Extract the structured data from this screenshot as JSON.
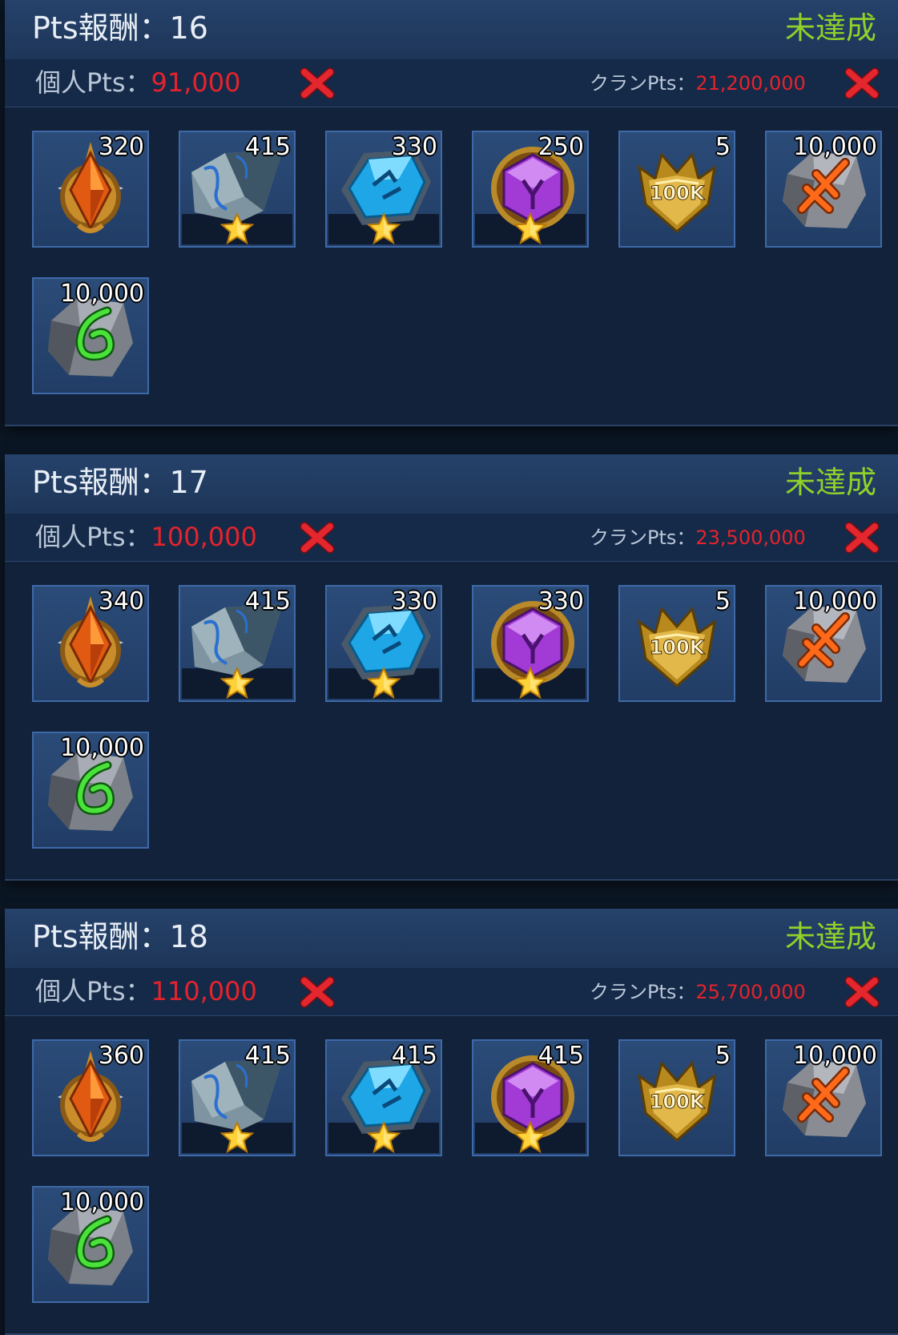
{
  "colors": {
    "status": "#8fd12a",
    "requirement_value": "#e5232c",
    "panel_bg": "#12223a",
    "header_bg": "#24406a"
  },
  "panels": [
    {
      "title": "Pts報酬：16",
      "status": "未達成",
      "personal_label": "個人Pts：",
      "personal_value": "91,000",
      "clan_label": "クランPts：",
      "clan_value": "21,200,000",
      "items": [
        {
          "icon": "orange-gem-emblem",
          "count": "320",
          "star": false
        },
        {
          "icon": "grey-stone-shard",
          "count": "415",
          "star": true
        },
        {
          "icon": "blue-crystal-rune",
          "count": "330",
          "star": true
        },
        {
          "icon": "purple-rune-medallion",
          "count": "250",
          "star": true
        },
        {
          "icon": "gold-100k-crest",
          "count": "5",
          "star": false,
          "badge": "100K"
        },
        {
          "icon": "orange-rune-stone",
          "count": "10,000",
          "star": false
        },
        {
          "icon": "green-rune-stone",
          "count": "10,000",
          "star": false
        }
      ]
    },
    {
      "title": "Pts報酬：17",
      "status": "未達成",
      "personal_label": "個人Pts：",
      "personal_value": "100,000",
      "clan_label": "クランPts：",
      "clan_value": "23,500,000",
      "items": [
        {
          "icon": "orange-gem-emblem",
          "count": "340",
          "star": false
        },
        {
          "icon": "grey-stone-shard",
          "count": "415",
          "star": true
        },
        {
          "icon": "blue-crystal-rune",
          "count": "330",
          "star": true
        },
        {
          "icon": "purple-rune-medallion",
          "count": "330",
          "star": true
        },
        {
          "icon": "gold-100k-crest",
          "count": "5",
          "star": false,
          "badge": "100K"
        },
        {
          "icon": "orange-rune-stone",
          "count": "10,000",
          "star": false
        },
        {
          "icon": "green-rune-stone",
          "count": "10,000",
          "star": false
        }
      ]
    },
    {
      "title": "Pts報酬：18",
      "status": "未達成",
      "personal_label": "個人Pts：",
      "personal_value": "110,000",
      "clan_label": "クランPts：",
      "clan_value": "25,700,000",
      "items": [
        {
          "icon": "orange-gem-emblem",
          "count": "360",
          "star": false
        },
        {
          "icon": "grey-stone-shard",
          "count": "415",
          "star": true
        },
        {
          "icon": "blue-crystal-rune",
          "count": "415",
          "star": true
        },
        {
          "icon": "purple-rune-medallion",
          "count": "415",
          "star": true
        },
        {
          "icon": "gold-100k-crest",
          "count": "5",
          "star": false,
          "badge": "100K"
        },
        {
          "icon": "orange-rune-stone",
          "count": "10,000",
          "star": false
        },
        {
          "icon": "green-rune-stone",
          "count": "10,000",
          "star": false
        }
      ]
    }
  ]
}
